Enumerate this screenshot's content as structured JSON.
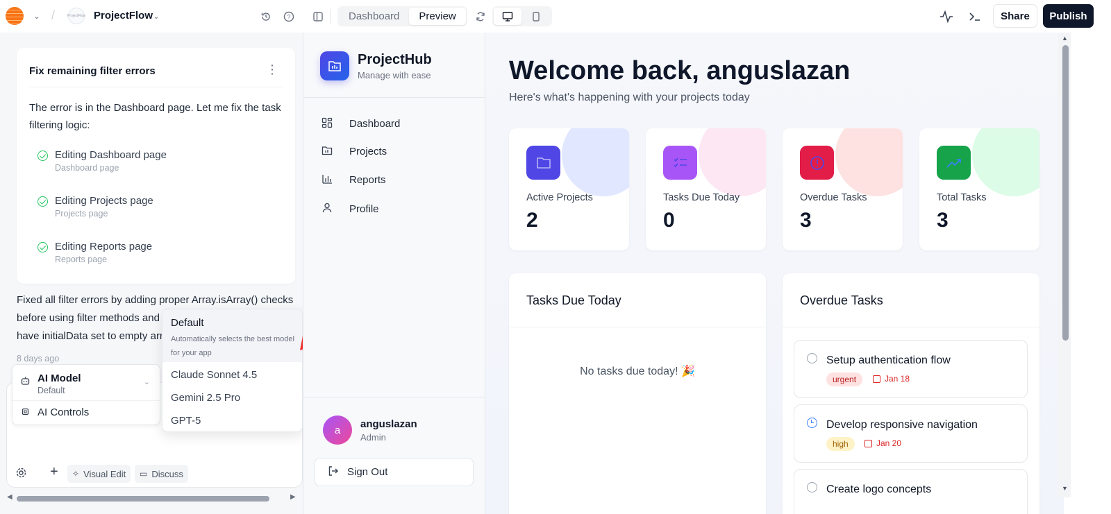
{
  "topbar": {
    "project_name": "ProjectFlow",
    "project_avatar_text": "ProjectFlow",
    "view_tabs": [
      "Dashboard",
      "Preview"
    ],
    "active_view": "Preview",
    "share_label": "Share",
    "publish_label": "Publish"
  },
  "chat": {
    "task_card": {
      "title": "Fix remaining filter errors",
      "description": "The error is in the Dashboard page. Let me fix the task filtering logic:",
      "edits": [
        {
          "label": "Editing Dashboard page",
          "sub": "Dashboard page"
        },
        {
          "label": "Editing Projects page",
          "sub": "Projects page"
        },
        {
          "label": "Editing Reports page",
          "sub": "Reports page"
        }
      ]
    },
    "message_lines": [
      "Fixed all filter errors by adding proper Array.isArray() checks",
      "before using filter methods and e",
      "have initialData set to empty arra"
    ],
    "message_time": "8 days ago",
    "ai_menu": {
      "model_title": "AI Model",
      "model_value": "Default",
      "controls_label": "AI Controls"
    },
    "model_popover": {
      "default_name": "Default",
      "default_desc": "Automatically selects the best model for your app",
      "options": [
        "Claude Sonnet 4.5",
        "Gemini 2.5 Pro",
        "GPT-5"
      ]
    },
    "toolbar": {
      "visual_edit_label": "Visual Edit",
      "discuss_label": "Discuss"
    }
  },
  "app": {
    "name": "ProjectHub",
    "tagline": "Manage with ease",
    "nav": [
      {
        "label": "Dashboard",
        "icon": "dashboard-icon"
      },
      {
        "label": "Projects",
        "icon": "folder-icon"
      },
      {
        "label": "Reports",
        "icon": "bar-chart-icon"
      },
      {
        "label": "Profile",
        "icon": "user-icon"
      }
    ],
    "user": {
      "initial": "a",
      "name": "anguslazan",
      "role": "Admin"
    },
    "sign_out_label": "Sign Out",
    "welcome_title": "Welcome back, anguslazan",
    "welcome_sub": "Here's what's happening with your projects today",
    "stats": [
      {
        "label": "Active Projects",
        "value": "2",
        "color": "#4f46e5",
        "blob": "#e0e7ff",
        "icon": "folder-icon"
      },
      {
        "label": "Tasks Due Today",
        "value": "0",
        "color": "#a855f7",
        "blob": "#fce7f3",
        "icon": "checklist-icon"
      },
      {
        "label": "Overdue Tasks",
        "value": "3",
        "color": "#e11d48",
        "blob": "#fee2e2",
        "icon": "alert-circle-icon"
      },
      {
        "label": "Total Tasks",
        "value": "3",
        "color": "#16a34a",
        "blob": "#dcfce7",
        "icon": "trending-up-icon"
      }
    ],
    "due_today": {
      "title": "Tasks Due Today",
      "empty": "No tasks due today! 🎉"
    },
    "overdue": {
      "title": "Overdue Tasks",
      "items": [
        {
          "title": "Setup authentication flow",
          "priority": "urgent",
          "date": "Jan 18"
        },
        {
          "title": "Develop responsive navigation",
          "priority": "high",
          "date": "Jan 20"
        },
        {
          "title": "Create logo concepts",
          "priority": "",
          "date": ""
        }
      ]
    }
  }
}
